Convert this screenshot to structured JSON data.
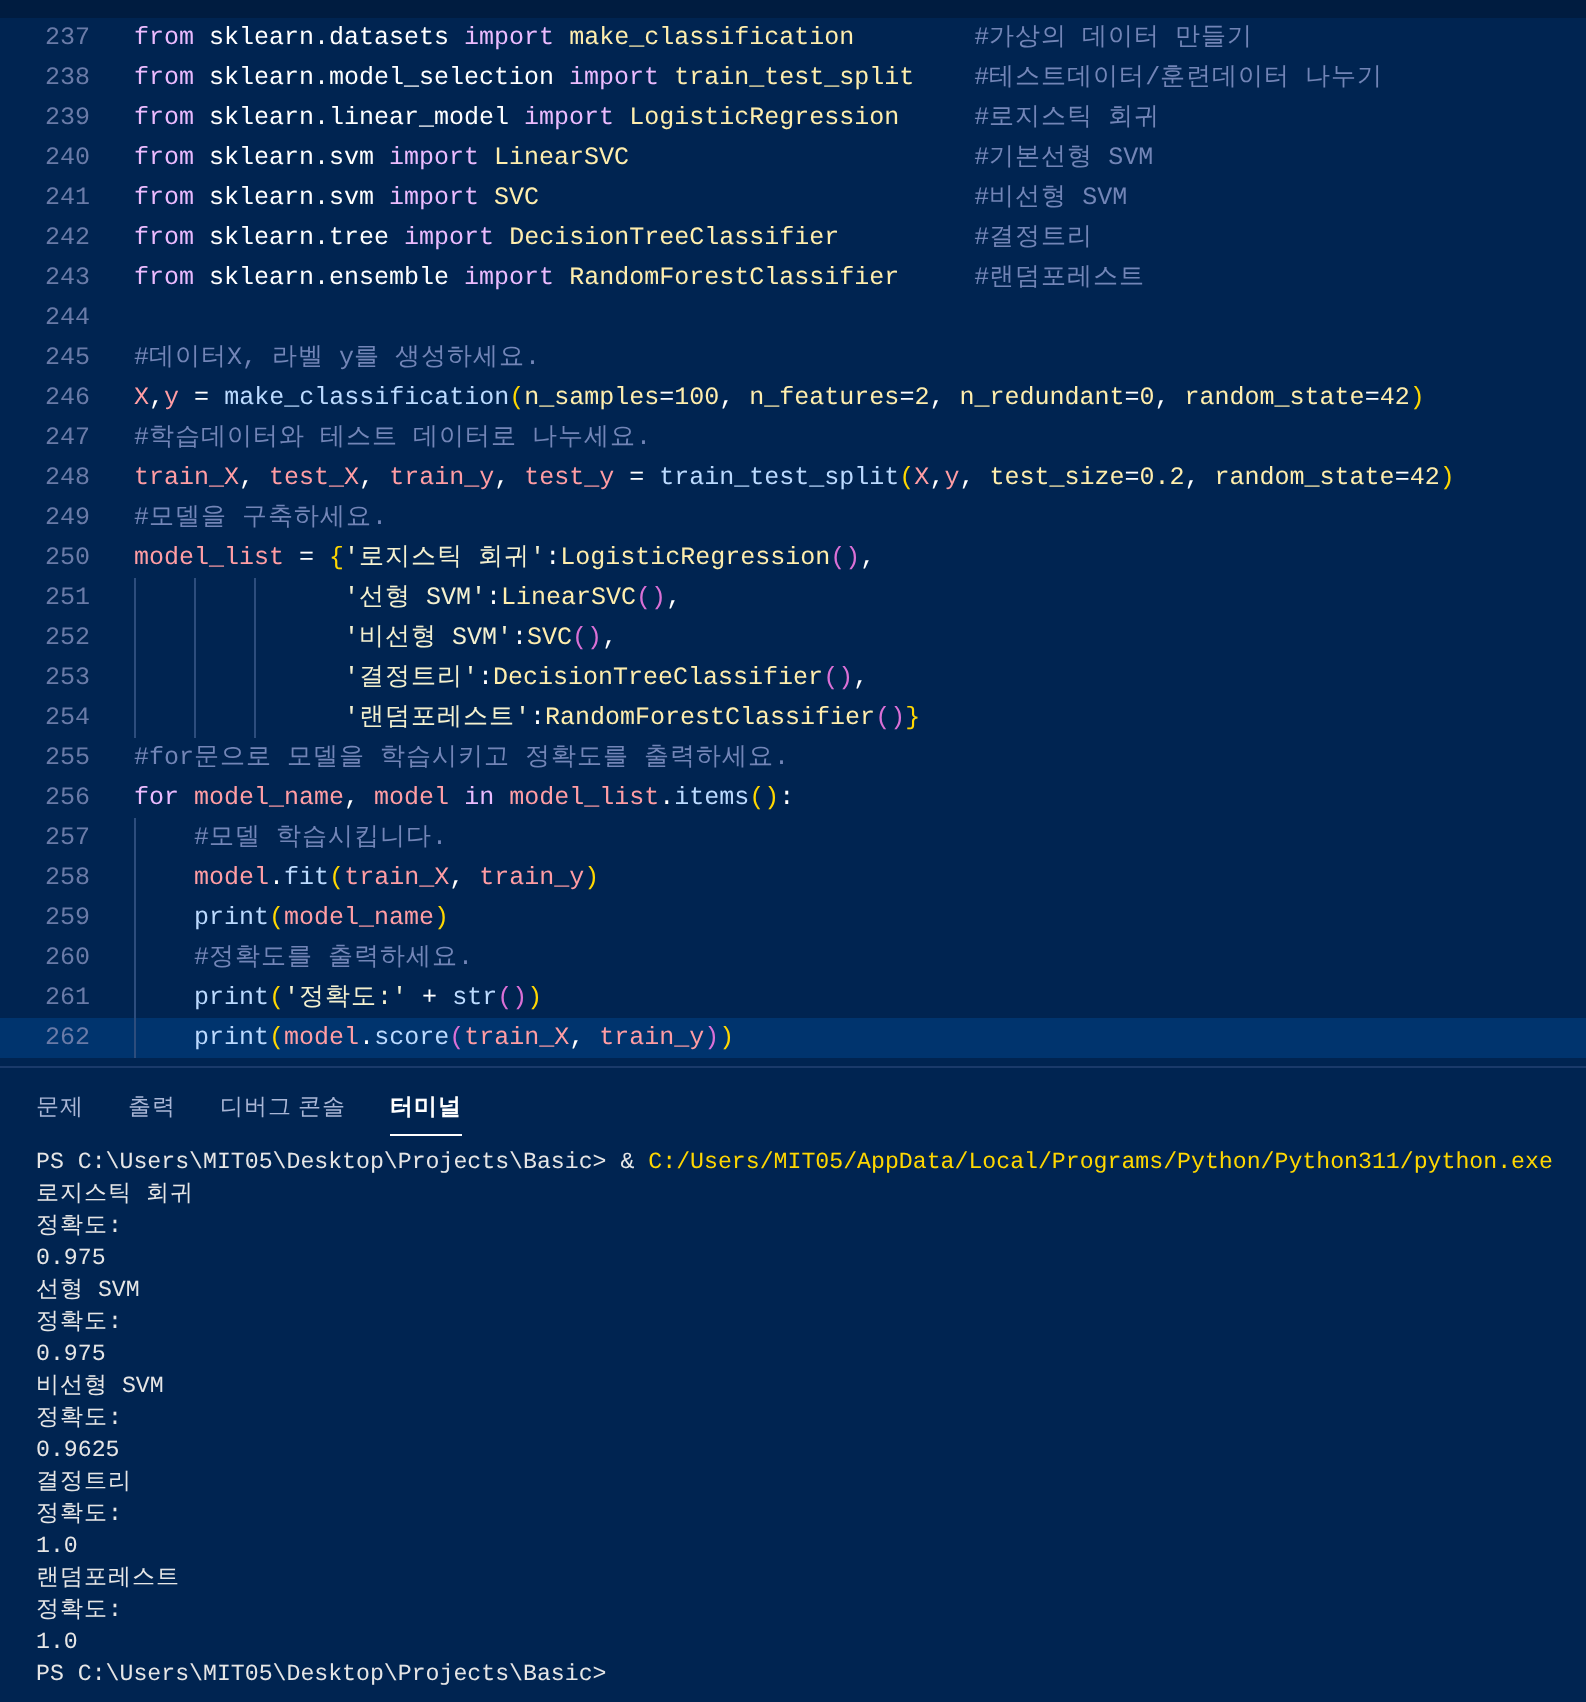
{
  "editor": {
    "lines": [
      {
        "number": "237",
        "current": false,
        "tokens": [
          {
            "kind": "keyword",
            "text": "from"
          },
          {
            "kind": "module",
            "text": " sklearn.datasets"
          },
          {
            "kind": "keyword",
            "text": " import"
          },
          {
            "kind": "class",
            "text": " make_classification"
          }
        ],
        "comment": "#가상의 데이터 만들기"
      },
      {
        "number": "238",
        "current": false,
        "tokens": [
          {
            "kind": "keyword",
            "text": "from"
          },
          {
            "kind": "module",
            "text": " sklearn.model_selection"
          },
          {
            "kind": "keyword",
            "text": " import"
          },
          {
            "kind": "class",
            "text": " train_test_split"
          }
        ],
        "comment": "#테스트데이터/훈련데이터 나누기"
      },
      {
        "number": "239",
        "current": false,
        "tokens": [
          {
            "kind": "keyword",
            "text": "from"
          },
          {
            "kind": "module",
            "text": " sklearn.linear_model"
          },
          {
            "kind": "keyword",
            "text": " import"
          },
          {
            "kind": "class",
            "text": " LogisticRegression"
          }
        ],
        "comment": "#로지스틱 회귀"
      },
      {
        "number": "240",
        "current": false,
        "tokens": [
          {
            "kind": "keyword",
            "text": "from"
          },
          {
            "kind": "module",
            "text": " sklearn.svm"
          },
          {
            "kind": "keyword",
            "text": " import"
          },
          {
            "kind": "class",
            "text": " LinearSVC"
          }
        ],
        "comment": "#기본선형 SVM"
      },
      {
        "number": "241",
        "current": false,
        "tokens": [
          {
            "kind": "keyword",
            "text": "from"
          },
          {
            "kind": "module",
            "text": " sklearn.svm"
          },
          {
            "kind": "keyword",
            "text": " import"
          },
          {
            "kind": "class",
            "text": " SVC"
          }
        ],
        "comment": "#비선형 SVM"
      },
      {
        "number": "242",
        "current": false,
        "tokens": [
          {
            "kind": "keyword",
            "text": "from"
          },
          {
            "kind": "module",
            "text": " sklearn.tree"
          },
          {
            "kind": "keyword",
            "text": " import"
          },
          {
            "kind": "class",
            "text": " DecisionTreeClassifier"
          }
        ],
        "comment": "#결정트리"
      },
      {
        "number": "243",
        "current": false,
        "tokens": [
          {
            "kind": "keyword",
            "text": "from"
          },
          {
            "kind": "module",
            "text": " sklearn.ensemble"
          },
          {
            "kind": "keyword",
            "text": " import"
          },
          {
            "kind": "class",
            "text": " RandomForestClassifier"
          }
        ],
        "comment": "#랜덤포레스트"
      },
      {
        "number": "244",
        "current": false
      },
      {
        "number": "245",
        "current": false,
        "tokens": [
          {
            "kind": "comment",
            "text": "#데이터X, 라벨 y를 생성하세요."
          }
        ]
      },
      {
        "number": "246",
        "current": false,
        "tokens": [
          {
            "kind": "variable",
            "text": "X"
          },
          {
            "kind": "symbol",
            "text": ","
          },
          {
            "kind": "variable",
            "text": "y"
          },
          {
            "kind": "symbol",
            "text": " = "
          },
          {
            "kind": "function",
            "text": "make_classification"
          },
          {
            "kind": "bracket",
            "text": "("
          },
          {
            "kind": "argument",
            "text": "n_samples"
          },
          {
            "kind": "symbol",
            "text": "="
          },
          {
            "kind": "argument",
            "text": "100"
          },
          {
            "kind": "symbol",
            "text": ", "
          },
          {
            "kind": "argument",
            "text": "n_features"
          },
          {
            "kind": "symbol",
            "text": "="
          },
          {
            "kind": "argument",
            "text": "2"
          },
          {
            "kind": "symbol",
            "text": ", "
          },
          {
            "kind": "argument",
            "text": "n_redundant"
          },
          {
            "kind": "symbol",
            "text": "="
          },
          {
            "kind": "argument",
            "text": "0"
          },
          {
            "kind": "symbol",
            "text": ", "
          },
          {
            "kind": "argument",
            "text": "random_state"
          },
          {
            "kind": "symbol",
            "text": "="
          },
          {
            "kind": "argument",
            "text": "42"
          },
          {
            "kind": "bracket",
            "text": ")"
          }
        ]
      },
      {
        "number": "247",
        "current": false,
        "tokens": [
          {
            "kind": "comment",
            "text": "#학습데이터와 테스트 데이터로 나누세요."
          }
        ]
      },
      {
        "number": "248",
        "current": false,
        "tokens": [
          {
            "kind": "variable",
            "text": "train_X"
          },
          {
            "kind": "symbol",
            "text": ", "
          },
          {
            "kind": "variable",
            "text": "test_X"
          },
          {
            "kind": "symbol",
            "text": ", "
          },
          {
            "kind": "variable",
            "text": "train_y"
          },
          {
            "kind": "symbol",
            "text": ", "
          },
          {
            "kind": "variable",
            "text": "test_y"
          },
          {
            "kind": "symbol",
            "text": " = "
          },
          {
            "kind": "function",
            "text": "train_test_split"
          },
          {
            "kind": "bracket",
            "text": "("
          },
          {
            "kind": "variable",
            "text": "X"
          },
          {
            "kind": "symbol",
            "text": ","
          },
          {
            "kind": "variable",
            "text": "y"
          },
          {
            "kind": "symbol",
            "text": ", "
          },
          {
            "kind": "argument",
            "text": "test_size"
          },
          {
            "kind": "symbol",
            "text": "="
          },
          {
            "kind": "argument",
            "text": "0.2"
          },
          {
            "kind": "symbol",
            "text": ", "
          },
          {
            "kind": "argument",
            "text": "random_state"
          },
          {
            "kind": "symbol",
            "text": "="
          },
          {
            "kind": "argument",
            "text": "42"
          },
          {
            "kind": "bracket",
            "text": ")"
          }
        ]
      },
      {
        "number": "249",
        "current": false,
        "tokens": [
          {
            "kind": "comment",
            "text": "#모델을 구축하세요."
          }
        ]
      },
      {
        "number": "250",
        "current": false,
        "kind": "dict",
        "tokens": [
          {
            "kind": "variable",
            "text": "model_list"
          },
          {
            "kind": "symbol",
            "text": " = "
          },
          {
            "kind": "bracket",
            "text": "{"
          },
          {
            "kind": "string",
            "text": "'로지스틱 회귀'"
          },
          {
            "kind": "symbol",
            "text": ":"
          },
          {
            "kind": "class",
            "text": "LogisticRegression"
          },
          {
            "kind": "bracket2",
            "text": "()"
          },
          {
            "kind": "symbol",
            "text": ","
          }
        ],
        "children": [
          {
            "number": "251",
            "current": false,
            "tokens": [
              {
                "kind": "string",
                "text": "'선형 SVM'"
              },
              {
                "kind": "symbol",
                "text": ":"
              },
              {
                "kind": "class",
                "text": "LinearSVC"
              },
              {
                "kind": "bracket2",
                "text": "()"
              },
              {
                "kind": "symbol",
                "text": ","
              }
            ]
          },
          {
            "number": "252",
            "current": false,
            "tokens": [
              {
                "kind": "string",
                "text": "'비선형 SVM'"
              },
              {
                "kind": "symbol",
                "text": ":"
              },
              {
                "kind": "class",
                "text": "SVC"
              },
              {
                "kind": "bracket2",
                "text": "()"
              },
              {
                "kind": "symbol",
                "text": ","
              }
            ]
          },
          {
            "number": "253",
            "current": false,
            "tokens": [
              {
                "kind": "string",
                "text": "'결정트리'"
              },
              {
                "kind": "symbol",
                "text": ":"
              },
              {
                "kind": "class",
                "text": "DecisionTreeClassifier"
              },
              {
                "kind": "bracket2",
                "text": "()"
              },
              {
                "kind": "symbol",
                "text": ","
              }
            ]
          },
          {
            "number": "254",
            "current": false,
            "tokens": [
              {
                "kind": "string",
                "text": "'랜덤포레스트'"
              },
              {
                "kind": "symbol",
                "text": ":"
              },
              {
                "kind": "class",
                "text": "RandomForestClassifier"
              },
              {
                "kind": "bracket2",
                "text": "()"
              },
              {
                "kind": "bracket",
                "text": "}"
              }
            ]
          }
        ]
      },
      {
        "number": "255",
        "current": false,
        "tokens": [
          {
            "kind": "comment",
            "text": "#for문으로 모델을 학습시키고 정확도를 출력하세요."
          }
        ]
      },
      {
        "number": "256",
        "current": false,
        "kind": "loop",
        "tokens": [
          {
            "kind": "keyword",
            "text": "for"
          },
          {
            "kind": "variable",
            "text": " model_name"
          },
          {
            "kind": "symbol",
            "text": ", "
          },
          {
            "kind": "variable",
            "text": "model"
          },
          {
            "kind": "keyword",
            "text": " in"
          },
          {
            "kind": "variable",
            "text": " model_list"
          },
          {
            "kind": "symbol",
            "text": "."
          },
          {
            "kind": "function",
            "text": "items"
          },
          {
            "kind": "bracket",
            "text": "()"
          },
          {
            "kind": "symbol",
            "text": ":"
          }
        ],
        "children": [
          {
            "number": "257",
            "current": false,
            "tokens": [
              {
                "kind": "comment",
                "text": "#모델 학습시킵니다."
              }
            ]
          },
          {
            "number": "258",
            "current": false,
            "tokens": [
              {
                "kind": "variable",
                "text": "model"
              },
              {
                "kind": "symbol",
                "text": "."
              },
              {
                "kind": "function",
                "text": "fit"
              },
              {
                "kind": "bracket",
                "text": "("
              },
              {
                "kind": "variable",
                "text": "train_X"
              },
              {
                "kind": "symbol",
                "text": ", "
              },
              {
                "kind": "variable",
                "text": "train_y"
              },
              {
                "kind": "bracket",
                "text": ")"
              }
            ]
          },
          {
            "number": "259",
            "current": false,
            "tokens": [
              {
                "kind": "function",
                "text": "print"
              },
              {
                "kind": "bracket",
                "text": "("
              },
              {
                "kind": "variable",
                "text": "model_name"
              },
              {
                "kind": "bracket",
                "text": ")"
              }
            ]
          },
          {
            "number": "260",
            "current": false,
            "tokens": [
              {
                "kind": "comment",
                "text": "#정확도를 출력하세요."
              }
            ]
          },
          {
            "number": "261",
            "current": false,
            "tokens": [
              {
                "kind": "function",
                "text": "print"
              },
              {
                "kind": "bracket",
                "text": "("
              },
              {
                "kind": "string",
                "text": "'정확도:'"
              },
              {
                "kind": "symbol",
                "text": " + "
              },
              {
                "kind": "function",
                "text": "str"
              },
              {
                "kind": "bracket2",
                "text": "()"
              },
              {
                "kind": "bracket",
                "text": ")"
              }
            ]
          },
          {
            "number": "262",
            "current": true,
            "tokens": [
              {
                "kind": "function",
                "text": "print"
              },
              {
                "kind": "bracket",
                "text": "("
              },
              {
                "kind": "variable",
                "text": "model"
              },
              {
                "kind": "symbol",
                "text": "."
              },
              {
                "kind": "function",
                "text": "score"
              },
              {
                "kind": "bracket2",
                "text": "("
              },
              {
                "kind": "variable",
                "text": "train_X"
              },
              {
                "kind": "symbol",
                "text": ", "
              },
              {
                "kind": "variable",
                "text": "train_y"
              },
              {
                "kind": "bracket2",
                "text": ")"
              },
              {
                "kind": "bracket",
                "text": ")"
              }
            ]
          }
        ]
      }
    ]
  },
  "panel": {
    "tabs": [
      {
        "label": "문제",
        "selected": false
      },
      {
        "label": "출력",
        "selected": false
      },
      {
        "label": "디버그 콘솔",
        "selected": false
      },
      {
        "label": "터미널",
        "selected": true
      }
    ]
  },
  "terminal": {
    "lines": [
      {
        "kind": "command",
        "prompt": "PS C:\\Users\\MIT05\\Desktop\\Projects\\Basic>",
        "operator": "&",
        "command": "C:/Users/MIT05/AppData/Local/Programs/Python/Python311/python.exe"
      },
      {
        "kind": "output",
        "text": "로지스틱 회귀"
      },
      {
        "kind": "output",
        "text": "정확도:"
      },
      {
        "kind": "output",
        "text": "0.975"
      },
      {
        "kind": "output",
        "text": "선형 SVM"
      },
      {
        "kind": "output",
        "text": "정확도:"
      },
      {
        "kind": "output",
        "text": "0.975"
      },
      {
        "kind": "output",
        "text": "비선형 SVM"
      },
      {
        "kind": "output",
        "text": "정확도:"
      },
      {
        "kind": "output",
        "text": "0.9625"
      },
      {
        "kind": "output",
        "text": "결정트리"
      },
      {
        "kind": "output",
        "text": "정확도:"
      },
      {
        "kind": "output",
        "text": "1.0"
      },
      {
        "kind": "output",
        "text": "랜덤포레스트"
      },
      {
        "kind": "output",
        "text": "정확도:"
      },
      {
        "kind": "output",
        "text": "1.0"
      },
      {
        "kind": "prompt",
        "prompt": "PS C:\\Users\\MIT05\\Desktop\\Projects\\Basic>"
      }
    ]
  }
}
